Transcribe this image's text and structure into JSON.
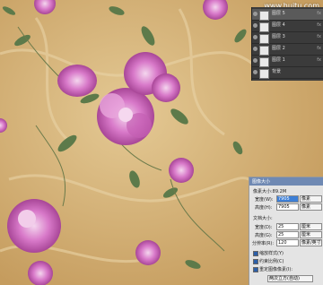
{
  "watermark": "www.huitu.com",
  "colors": {
    "background": "#cfa96e",
    "flower": "#d879c9",
    "flower_dark": "#b24fa5",
    "leaf": "#5d7a4a",
    "panel": "#3b3b3b",
    "dialog": "#e4e4e4",
    "dialog_title": "#6f89b3"
  },
  "layers_panel": {
    "rows": [
      {
        "label": "图层 5",
        "tag": "fx",
        "active": true
      },
      {
        "label": "图层 4",
        "tag": "fx",
        "active": false
      },
      {
        "label": "图层 3",
        "tag": "fx",
        "active": false
      },
      {
        "label": "图层 2",
        "tag": "fx",
        "active": false
      },
      {
        "label": "图层 1",
        "tag": "fx",
        "active": false
      },
      {
        "label": "背景",
        "tag": "",
        "active": false
      }
    ]
  },
  "image_size_dialog": {
    "title": "图像大小",
    "pixel_dim_label": "像素大小:89.2M",
    "width_label": "宽度(W):",
    "width_value": "7905",
    "height_label": "高度(H):",
    "height_value": "7905",
    "unit_pixels": "像素",
    "doc_size_label": "文档大小:",
    "doc_width_label": "宽度(D):",
    "doc_width_value": "25",
    "doc_height_label": "高度(G):",
    "doc_height_value": "25",
    "resolution_label": "分辨率(R):",
    "resolution_value": "120",
    "unit_cm": "厘米",
    "unit_ppi": "像素/英寸",
    "scale_styles": "缩放样式(Y)",
    "constrain": "约束比例(C)",
    "resample": "重定图像像素(I):",
    "resample_method": "两次立方(自动)"
  }
}
